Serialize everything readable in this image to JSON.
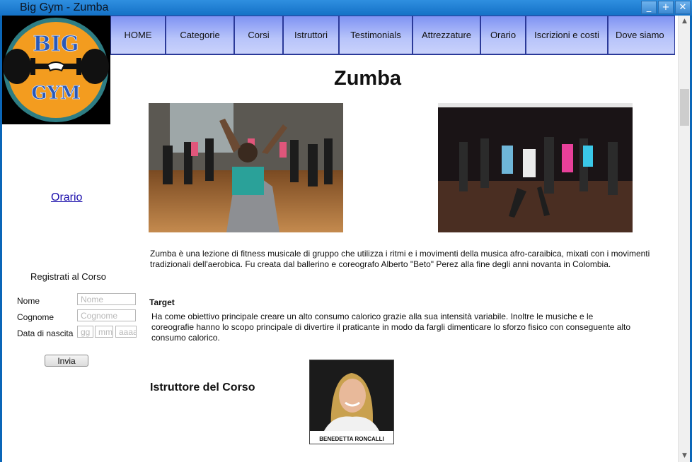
{
  "window": {
    "title": "Big Gym - Zumba",
    "buttons": [
      "_",
      "+",
      "✕"
    ]
  },
  "logo": {
    "top_text": "BIG",
    "bottom_text": "GYM"
  },
  "nav": {
    "items": [
      "HOME",
      "Categorie",
      "Corsi",
      "Istruttori",
      "Testimonials",
      "Attrezzature",
      "Orario",
      "Iscrizioni e costi",
      "Dove siamo"
    ]
  },
  "sidebar": {
    "orario_link": "Orario",
    "form": {
      "title": "Registrati al Corso",
      "name_label": "Nome",
      "name_placeholder": "Nome",
      "surname_label": "Cognome",
      "surname_placeholder": "Cognome",
      "dob_label": "Data di nascita",
      "dob_day_placeholder": "gg",
      "dob_month_placeholder": "mm",
      "dob_year_placeholder": "aaaa",
      "submit_label": "Invia"
    }
  },
  "main": {
    "title": "Zumba",
    "intro": "Zumba è una lezione di fitness musicale di gruppo che utilizza i ritmi e i movimenti della musica afro-caraibica, mixati con i movimenti tradizionali dell'aerobica. Fu creata dal ballerino e coreografo Alberto \"Beto\" Perez  alla fine degli anni novanta in Colombia.",
    "target_heading": "Target",
    "target_text": "Ha come obiettivo principale creare un alto consumo calorico grazie alla sua intensità variabile. Inoltre le musiche e le coreografie hanno lo scopo principale di divertire il praticante in modo da fargli dimenticare lo sforzo fisico con conseguente alto consumo calorico.",
    "instructor_heading": "Istruttore del Corso",
    "instructor_name": "BENEDETTA RONCALLI"
  },
  "colors": {
    "titlebar": "#1a78cc",
    "nav_top": "#7f93f3",
    "nav_bottom": "#c9d2fb",
    "nav_border": "#2b3a99",
    "logo_orange": "#f39c1f",
    "logo_teal": "#2e7d83",
    "link": "#1a0dab"
  }
}
